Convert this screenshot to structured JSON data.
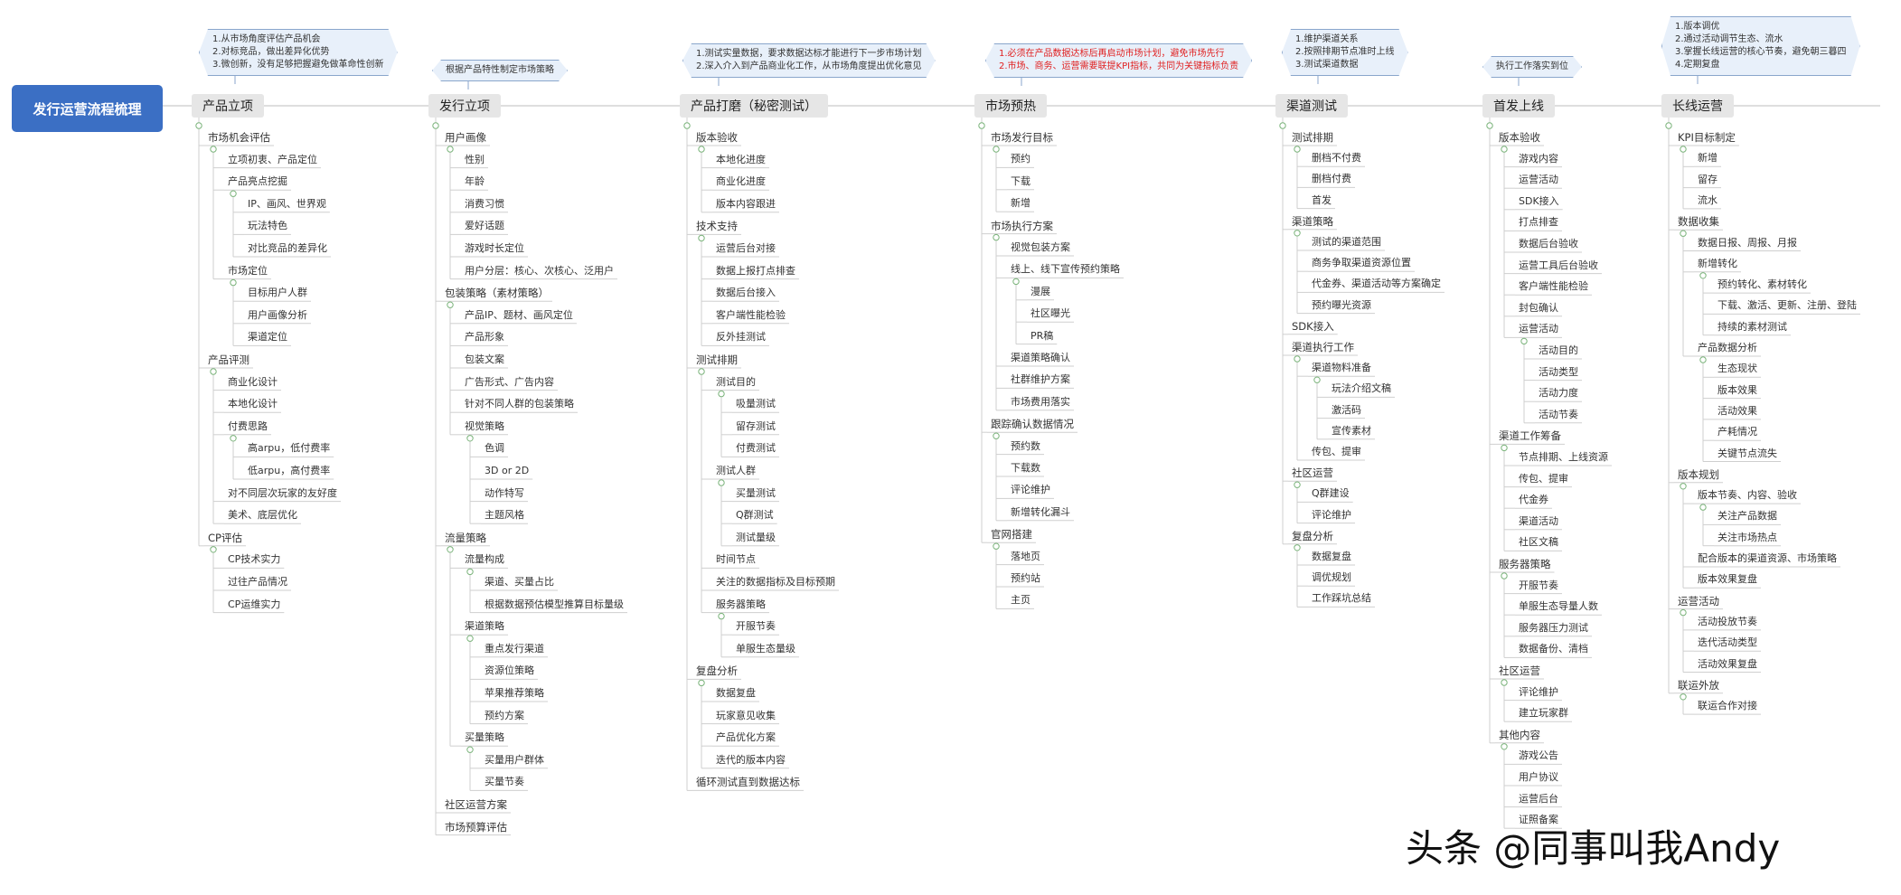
{
  "root": "发行运营流程梳理",
  "watermark": "头条 @同事叫我Andy",
  "stages": [
    {
      "title": "产品立项",
      "callout": [
        "1.从市场角度评估产品机会",
        "2.对标竞品，做出差异化优势",
        "3.微创新，没有足够把握避免做革命性创新"
      ],
      "children": [
        {
          "text": "市场机会评估",
          "children": [
            {
              "text": "立项初衷、产品定位"
            },
            {
              "text": "产品亮点挖掘",
              "children": [
                {
                  "text": "IP、画风、世界观"
                },
                {
                  "text": "玩法特色"
                },
                {
                  "text": "对比竞品的差异化"
                }
              ]
            },
            {
              "text": "市场定位",
              "children": [
                {
                  "text": "目标用户人群"
                },
                {
                  "text": "用户画像分析"
                },
                {
                  "text": "渠道定位"
                }
              ]
            }
          ]
        },
        {
          "text": "产品评测",
          "children": [
            {
              "text": "商业化设计"
            },
            {
              "text": "本地化设计"
            },
            {
              "text": "付费思路",
              "children": [
                {
                  "text": "高arpu，低付费率"
                },
                {
                  "text": "低arpu，高付费率"
                }
              ]
            },
            {
              "text": "对不同层次玩家的友好度"
            },
            {
              "text": "美术、底层优化"
            }
          ]
        },
        {
          "text": "CP评估",
          "children": [
            {
              "text": "CP技术实力"
            },
            {
              "text": "过往产品情况"
            },
            {
              "text": "CP运维实力"
            }
          ]
        }
      ]
    },
    {
      "title": "发行立项",
      "callout": [
        "根据产品特性制定市场策略"
      ],
      "children": [
        {
          "text": "用户画像",
          "children": [
            {
              "text": "性别"
            },
            {
              "text": "年龄"
            },
            {
              "text": "消费习惯"
            },
            {
              "text": "爱好话题"
            },
            {
              "text": "游戏时长定位"
            },
            {
              "text": "用户分层：核心、次核心、泛用户"
            }
          ]
        },
        {
          "text": "包装策略（素材策略）",
          "children": [
            {
              "text": "产品IP、题材、画风定位"
            },
            {
              "text": "产品形象"
            },
            {
              "text": "包装文案"
            },
            {
              "text": "广告形式、广告内容"
            },
            {
              "text": "针对不同人群的包装策略"
            },
            {
              "text": "视觉策略",
              "children": [
                {
                  "text": "色调"
                },
                {
                  "text": "3D or 2D"
                },
                {
                  "text": "动作特写"
                },
                {
                  "text": "主题风格"
                }
              ]
            }
          ]
        },
        {
          "text": "流量策略",
          "children": [
            {
              "text": "流量构成",
              "children": [
                {
                  "text": "渠道、买量占比"
                },
                {
                  "text": "根据数据预估模型推算目标量级"
                }
              ]
            },
            {
              "text": "渠道策略",
              "children": [
                {
                  "text": "重点发行渠道"
                },
                {
                  "text": "资源位策略"
                },
                {
                  "text": "苹果推荐策略"
                },
                {
                  "text": "预约方案"
                }
              ]
            },
            {
              "text": "买量策略",
              "children": [
                {
                  "text": "买量用户群体"
                },
                {
                  "text": "买量节奏"
                }
              ]
            }
          ]
        },
        {
          "text": "社区运营方案"
        },
        {
          "text": "市场预算评估"
        }
      ]
    },
    {
      "title": "产品打磨（秘密测试）",
      "callout": [
        "1.测试实量数据，要求数据达标才能进行下一步市场计划",
        "2.深入介入到产品商业化工作，从市场角度提出优化意见"
      ],
      "children": [
        {
          "text": "版本验收",
          "children": [
            {
              "text": "本地化进度"
            },
            {
              "text": "商业化进度"
            },
            {
              "text": "版本内容跟进"
            }
          ]
        },
        {
          "text": "技术支持",
          "children": [
            {
              "text": "运营后台对接"
            },
            {
              "text": "数据上报打点排查"
            },
            {
              "text": "数据后台接入"
            },
            {
              "text": "客户端性能检验"
            },
            {
              "text": "反外挂测试"
            }
          ]
        },
        {
          "text": "测试排期",
          "children": [
            {
              "text": "测试目的",
              "children": [
                {
                  "text": "吸量测试"
                },
                {
                  "text": "留存测试"
                },
                {
                  "text": "付费测试"
                }
              ]
            },
            {
              "text": "测试人群",
              "children": [
                {
                  "text": "买量测试"
                },
                {
                  "text": "Q群测试"
                },
                {
                  "text": "测试量级"
                }
              ]
            },
            {
              "text": "时间节点"
            },
            {
              "text": "关注的数据指标及目标预期"
            },
            {
              "text": "服务器策略",
              "children": [
                {
                  "text": "开服节奏"
                },
                {
                  "text": "单服生态量级"
                }
              ]
            }
          ]
        },
        {
          "text": "复盘分析",
          "children": [
            {
              "text": "数据复盘"
            },
            {
              "text": "玩家意见收集"
            },
            {
              "text": "产品优化方案"
            },
            {
              "text": "迭代的版本内容"
            }
          ]
        },
        {
          "text": "循环测试直到数据达标"
        }
      ]
    },
    {
      "title": "市场预热",
      "callout": [
        "1.必须在产品数据达标后再启动市场计划，避免市场先行",
        "2.市场、商务、运营需要联提KPI指标，共同为关键指标负责"
      ],
      "callout_red": true,
      "children": [
        {
          "text": "市场发行目标",
          "children": [
            {
              "text": "预约"
            },
            {
              "text": "下载"
            },
            {
              "text": "新增"
            }
          ]
        },
        {
          "text": "市场执行方案",
          "children": [
            {
              "text": "视觉包装方案"
            },
            {
              "text": "线上、线下宣传预约策略",
              "children": [
                {
                  "text": "漫展"
                },
                {
                  "text": "社区曝光"
                },
                {
                  "text": "PR稿"
                }
              ]
            },
            {
              "text": "渠道策略确认"
            },
            {
              "text": "社群维护方案"
            },
            {
              "text": "市场费用落实"
            }
          ]
        },
        {
          "text": "跟踪确认数据情况",
          "children": [
            {
              "text": "预约数"
            },
            {
              "text": "下载数"
            },
            {
              "text": "评论维护"
            },
            {
              "text": "新增转化漏斗"
            }
          ]
        },
        {
          "text": "官网搭建",
          "children": [
            {
              "text": "落地页"
            },
            {
              "text": "预约站"
            },
            {
              "text": "主页"
            }
          ]
        }
      ]
    },
    {
      "title": "渠道测试",
      "callout": [
        "1.维护渠道关系",
        "2.按照排期节点准时上线",
        "3.测试渠道数据"
      ],
      "children": [
        {
          "text": "测试排期",
          "children": [
            {
              "text": "删档不付费"
            },
            {
              "text": "删档付费"
            },
            {
              "text": "首发"
            }
          ]
        },
        {
          "text": "渠道策略",
          "children": [
            {
              "text": "测试的渠道范围"
            },
            {
              "text": "商务争取渠道资源位置"
            },
            {
              "text": "代金券、渠道活动等方案确定"
            },
            {
              "text": "预约曝光资源"
            }
          ]
        },
        {
          "text": "SDK接入"
        },
        {
          "text": "渠道执行工作",
          "children": [
            {
              "text": "渠道物料准备",
              "children": [
                {
                  "text": "玩法介绍文稿"
                },
                {
                  "text": "激活码"
                },
                {
                  "text": "宣传素材"
                }
              ]
            },
            {
              "text": "传包、提审"
            }
          ]
        },
        {
          "text": "社区运营",
          "children": [
            {
              "text": "Q群建设"
            },
            {
              "text": "评论维护"
            }
          ]
        },
        {
          "text": "复盘分析",
          "children": [
            {
              "text": "数据复盘"
            },
            {
              "text": "调优规划"
            },
            {
              "text": "工作踩坑总结"
            }
          ]
        }
      ]
    },
    {
      "title": "首发上线",
      "callout": [
        "执行工作落实到位"
      ],
      "children": [
        {
          "text": "版本验收",
          "children": [
            {
              "text": "游戏内容"
            },
            {
              "text": "运营活动"
            },
            {
              "text": "SDK接入"
            },
            {
              "text": "打点排查"
            },
            {
              "text": "数据后台验收"
            },
            {
              "text": "运营工具后台验收"
            },
            {
              "text": "客户端性能检验"
            },
            {
              "text": "封包确认"
            },
            {
              "text": "运营活动",
              "children": [
                {
                  "text": "活动目的"
                },
                {
                  "text": "活动类型"
                },
                {
                  "text": "活动力度"
                },
                {
                  "text": "活动节奏"
                }
              ]
            }
          ]
        },
        {
          "text": "渠道工作筹备",
          "children": [
            {
              "text": "节点排期、上线资源"
            },
            {
              "text": "传包、提审"
            },
            {
              "text": "代金券"
            },
            {
              "text": "渠道活动"
            },
            {
              "text": "社区文稿"
            }
          ]
        },
        {
          "text": "服务器策略",
          "children": [
            {
              "text": "开服节奏"
            },
            {
              "text": "单服生态导量人数"
            },
            {
              "text": "服务器压力测试"
            },
            {
              "text": "数据备份、清档"
            }
          ]
        },
        {
          "text": "社区运营",
          "children": [
            {
              "text": "评论维护"
            },
            {
              "text": "建立玩家群"
            }
          ]
        },
        {
          "text": "其他内容",
          "children": [
            {
              "text": "游戏公告"
            },
            {
              "text": "用户协议"
            },
            {
              "text": "运营后台"
            },
            {
              "text": "证照备案"
            }
          ]
        }
      ]
    },
    {
      "title": "长线运营",
      "callout": [
        "1.版本调优",
        "2.通过活动调节生态、流水",
        "3.掌握长线运营的核心节奏，避免朝三暮四",
        "4.定期复盘"
      ],
      "children": [
        {
          "text": "KPI目标制定",
          "children": [
            {
              "text": "新增"
            },
            {
              "text": "留存"
            },
            {
              "text": "流水"
            }
          ]
        },
        {
          "text": "数据收集",
          "children": [
            {
              "text": "数据日报、周报、月报"
            },
            {
              "text": "新增转化",
              "children": [
                {
                  "text": "预约转化、素材转化"
                },
                {
                  "text": "下载、激活、更新、注册、登陆"
                },
                {
                  "text": "持续的素材测试"
                }
              ]
            },
            {
              "text": "产品数据分析",
              "children": [
                {
                  "text": "生态现状"
                },
                {
                  "text": "版本效果"
                },
                {
                  "text": "活动效果"
                },
                {
                  "text": "产耗情况"
                },
                {
                  "text": "关键节点流失"
                }
              ]
            }
          ]
        },
        {
          "text": "版本规划",
          "children": [
            {
              "text": "版本节奏、内容、验收",
              "children": [
                {
                  "text": "关注产品数据"
                },
                {
                  "text": "关注市场热点"
                }
              ]
            },
            {
              "text": "配合版本的渠道资源、市场策略"
            },
            {
              "text": "版本效果复盘"
            }
          ]
        },
        {
          "text": "运营活动",
          "children": [
            {
              "text": "活动投放节奏"
            },
            {
              "text": "迭代活动类型"
            },
            {
              "text": "活动效果复盘"
            }
          ]
        },
        {
          "text": "联运外放",
          "children": [
            {
              "text": "联运合作对接"
            }
          ]
        }
      ]
    }
  ]
}
